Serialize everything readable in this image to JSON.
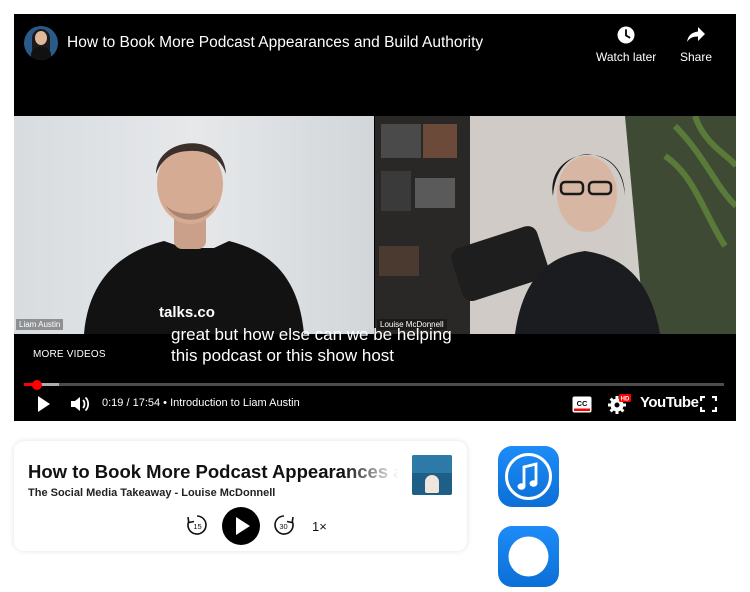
{
  "player": {
    "title": "How to Book More Podcast Appearances and Build Authority",
    "watch_later_label": "Watch later",
    "share_label": "Share",
    "left_speaker_name": "Liam Austin",
    "right_speaker_name": "Louise McDonnell",
    "shirt_logo_text": "talks.co",
    "caption_line_1": "great but how else can we be helping",
    "caption_line_2": "this podcast or this show host",
    "more_videos_label": "MORE VIDEOS",
    "progress_played_fraction": 0.018,
    "progress_buffered_fraction": 0.05,
    "time_display": "0:19 / 17:54",
    "chapter_separator": "•",
    "chapter_title": "Introduction to Liam Austin",
    "cc_label": "CC",
    "hd_badge": "HD",
    "youtube_logo": "YouTube",
    "icons": [
      "channel-avatar",
      "clock-icon",
      "share-arrow-icon",
      "play-icon",
      "volume-icon",
      "cc-icon",
      "settings-gear-icon",
      "fullscreen-icon"
    ]
  },
  "podcast": {
    "title": "How to Book More Podcast Appearances and Build Authority",
    "subtitle": "The Social Media Takeaway - Louise McDonnell",
    "rewind_seconds": "15",
    "forward_seconds": "30",
    "speed_label": "1×",
    "icons": [
      "rewind-15-icon",
      "play-icon",
      "forward-30-icon",
      "podcast-artwork"
    ]
  },
  "side_apps": {
    "icons": [
      "apple-podcasts-music-icon",
      "second-app-icon"
    ]
  },
  "colors": {
    "accent_red": "#ff0000",
    "app_blue": "#1d8cf8",
    "player_bg": "#000000"
  }
}
